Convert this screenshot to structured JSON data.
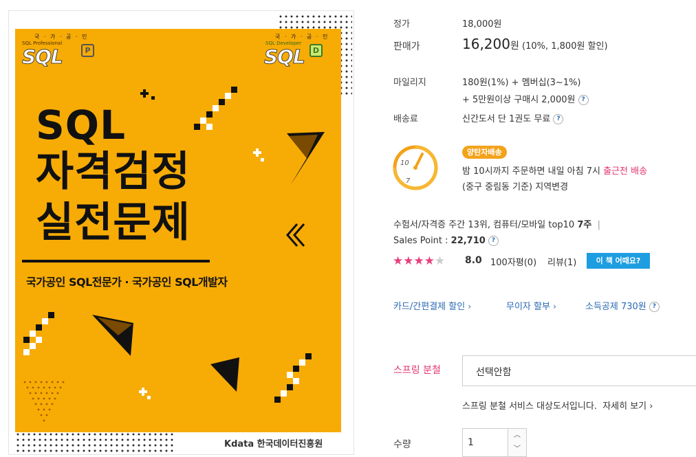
{
  "cover": {
    "badge_left_top": "국 · 가 · 공 · 인",
    "badge_left_sub": "SQL Professional",
    "badge_left_sql": "SQL",
    "badge_left_letter": "P",
    "badge_right_top": "국 · 가 · 공 · 인",
    "badge_right_sub": "SQL Developer",
    "badge_right_sql": "SQL",
    "badge_right_letter": "D",
    "title_line1": "SQL",
    "title_line2": "자격검정",
    "title_line3": "실전문제",
    "subtitle": "국가공인 SQL전문가 · 국가공인 SQL개발자",
    "publisher": "Kdata 한국데이터진흥원"
  },
  "price": {
    "list_label": "정가",
    "list_value": "18,000원",
    "sale_label": "판매가",
    "sale_amount": "16,200",
    "sale_unit": "원",
    "sale_discount": "(10%, 1,800원 할인)"
  },
  "mileage": {
    "label": "마일리지",
    "line1": "180원(1%) + 멤버십(3~1%)",
    "line2": "+ 5만원이상 구매시 2,000원"
  },
  "shipping": {
    "label": "배송료",
    "value": "신간도서 단 1권도 무료"
  },
  "delivery": {
    "clock_text_top": "10",
    "clock_text_bottom": "7",
    "badge": "양탄자배송",
    "line1_prefix": "밤 10시까지 주문하면 내일 아침 7시 ",
    "line1_highlight": "출근전 배송",
    "line2_prefix": "(중구 중림동 기준) ",
    "line2_link": "지역변경"
  },
  "ranking": {
    "text": "수험서/자격증 주간 13위, 컴퓨터/모바일 top10 ",
    "weeks": "7주",
    "sep": "|",
    "sales_point_label": "Sales Point : ",
    "sales_point_value": "22,710"
  },
  "rating": {
    "stars": 4,
    "max": 5,
    "score": "8.0",
    "reviews_100": "100자평(0)",
    "reviews": "리뷰(1)",
    "rate_button": "이 책 어때요?"
  },
  "benefits": {
    "card": "카드/간편결제 할인",
    "installment": "무이자 할부",
    "tax": "소득공제 730원"
  },
  "spring": {
    "label": "스프링 분철",
    "selected": "선택안함",
    "note": "스프링 분철 서비스 대상도서입니다.",
    "more": "자세히 보기"
  },
  "quantity": {
    "label": "수량",
    "value": "1"
  },
  "colors": {
    "cover_bg": "#f7ab05",
    "accent_pink": "#e2336f",
    "link_blue": "#2a6ab4",
    "button_blue": "#1e9de1",
    "star_pink": "#e93e7c",
    "delivery_orange": "#f3a21b"
  }
}
